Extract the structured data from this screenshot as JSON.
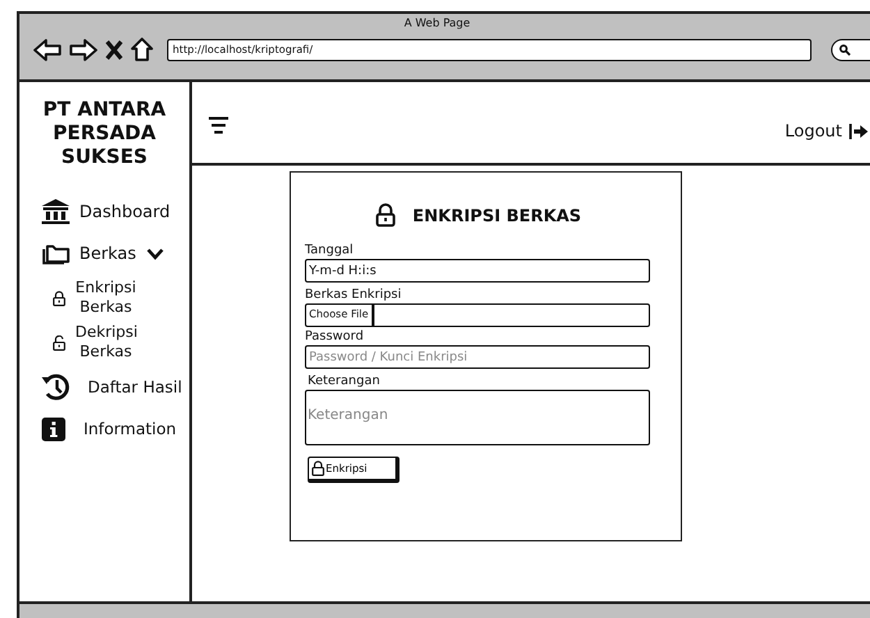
{
  "browser": {
    "title": "A Web Page",
    "url": "http://localhost/kriptografi/"
  },
  "sidebar": {
    "brand": "PT ANTARA PERSADA SUKSES",
    "items": [
      {
        "label": "Dashboard"
      },
      {
        "label": "Berkas",
        "expanded": true,
        "children": [
          {
            "label": "Enkripsi Berkas"
          },
          {
            "label": "Dekripsi Berkas"
          }
        ]
      },
      {
        "label": "Daftar Hasil"
      },
      {
        "label": "Information"
      }
    ]
  },
  "header": {
    "logout": "Logout"
  },
  "form": {
    "title": "ENKRIPSI BERKAS",
    "fields": [
      {
        "kind": "input",
        "label": "Tanggal",
        "value": "Y-m-d H:i:s"
      },
      {
        "kind": "file",
        "label": "Berkas Enkripsi",
        "button": "Choose File"
      },
      {
        "kind": "input",
        "label": "Password",
        "placeholder": "Password / Kunci Enkripsi"
      },
      {
        "kind": "textarea",
        "label": "Keterangan",
        "placeholder": "Keterangan"
      }
    ],
    "submit": "Enkripsi"
  }
}
